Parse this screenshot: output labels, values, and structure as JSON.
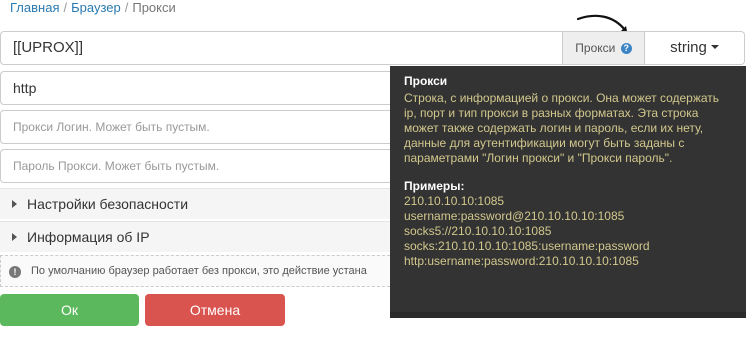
{
  "breadcrumb": {
    "items": [
      "Главная",
      "Браузер",
      "Прокси"
    ],
    "separator": "/"
  },
  "proxy": {
    "value": "[[UPROX]]",
    "addon_label": "Прокси",
    "help_glyph": "?",
    "type_label": "string"
  },
  "fields": {
    "type_value": "http",
    "login_placeholder": "Прокси Логин. Может быть пустым.",
    "password_placeholder": "Пароль Прокси. Может быть пустым."
  },
  "sections": [
    {
      "label": "Настройки безопасности"
    },
    {
      "label": "Информация об IP"
    }
  ],
  "info": {
    "icon_glyph": "!",
    "text": "По умолчанию браузер работает без прокси, это действие устана"
  },
  "buttons": {
    "ok": "Ок",
    "cancel": "Отмена"
  },
  "tooltip": {
    "title": "Прокси",
    "description": "Строка, с информацией о прокси. Она может содержать ip, порт и тип прокси в разных форматах. Эта строка может также содержать логин и пароль, если их нету, данные для аутентификации могут быть заданы с параметрами \"Логин прокси\" и \"Прокси пароль\".",
    "examples_title": "Примеры:",
    "examples": [
      "210.10.10.10:1085",
      "username:password@210.10.10.10:1085",
      "socks5://210.10.10.10:1085",
      "socks:210.10.10.10:1085:username:password",
      "http:username:password:210.10.10.10:1085"
    ]
  },
  "colors": {
    "ok_button": "#5cb85c",
    "cancel_button": "#d9534f",
    "tooltip_bg": "#333333",
    "tooltip_text": "#d2c88d",
    "help_icon": "#3c85c5"
  }
}
